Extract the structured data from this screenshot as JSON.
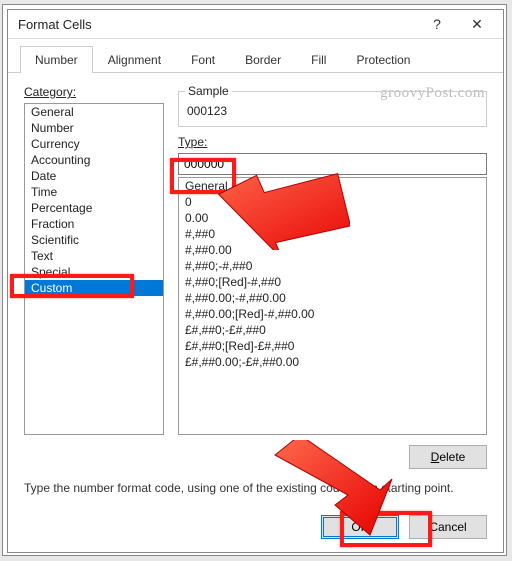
{
  "dialog": {
    "title": "Format Cells",
    "help_icon": "?",
    "close_icon": "✕"
  },
  "tabs": [
    "Number",
    "Alignment",
    "Font",
    "Border",
    "Fill",
    "Protection"
  ],
  "active_tab_index": 0,
  "watermark": "groovyPost.com",
  "category": {
    "label": "Category:",
    "items": [
      "General",
      "Number",
      "Currency",
      "Accounting",
      "Date",
      "Time",
      "Percentage",
      "Fraction",
      "Scientific",
      "Text",
      "Special",
      "Custom"
    ],
    "selected_index": 11
  },
  "sample": {
    "label": "Sample",
    "value": "000123"
  },
  "type": {
    "label": "Type:",
    "value": "000000"
  },
  "formats": [
    "General",
    "0",
    "0.00",
    "#,##0",
    "#,##0.00",
    "#,##0;-#,##0",
    "#,##0;[Red]-#,##0",
    "#,##0.00;-#,##0.00",
    "#,##0.00;[Red]-#,##0.00",
    "£#,##0;-£#,##0",
    "£#,##0;[Red]-£#,##0",
    "£#,##0.00;-£#,##0.00"
  ],
  "delete_label": "Delete",
  "hint": "Type the number format code, using one of the existing codes as a starting point.",
  "footer": {
    "ok": "OK",
    "cancel": "Cancel"
  }
}
